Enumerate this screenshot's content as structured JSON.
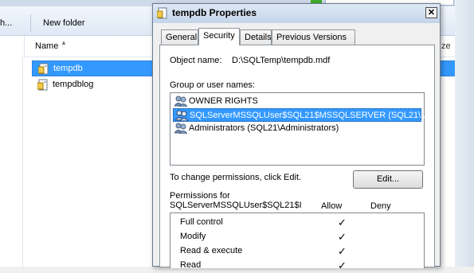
{
  "explorer": {
    "toolbar_partial_text": "h...",
    "new_folder_label": "New folder",
    "column_name_label": "Name",
    "column_size_partial": "ze",
    "files": [
      {
        "name": "tempdb",
        "selected": true
      },
      {
        "name": "tempdblog",
        "selected": false
      }
    ]
  },
  "dialog": {
    "title": "tempdb Properties",
    "close_glyph": "✕",
    "tabs": [
      {
        "label": "General",
        "active": false
      },
      {
        "label": "Security",
        "active": true
      },
      {
        "label": "Details",
        "active": false
      },
      {
        "label": "Previous Versions",
        "active": false
      }
    ],
    "object_name_label": "Object name:",
    "object_name_value": "D:\\SQLTemp\\tempdb.mdf",
    "group_label": "Group or user names:",
    "principals": [
      {
        "name": "OWNER RIGHTS",
        "selected": false
      },
      {
        "name": "SQLServerMSSQLUser$SQL21$MSSQLSERVER (SQL21\\...",
        "selected": true
      },
      {
        "name": "Administrators (SQL21\\Administrators)",
        "selected": false
      }
    ],
    "change_perm_text": "To change permissions, click Edit.",
    "edit_button_label": "Edit...",
    "permissions_for_line1": "Permissions for",
    "permissions_for_line2": "SQLServerMSSQLUser$SQL21$I",
    "allow_header": "Allow",
    "deny_header": "Deny",
    "check_glyph": "✓",
    "permissions": [
      {
        "name": "Full control",
        "allow": true,
        "deny": false
      },
      {
        "name": "Modify",
        "allow": true,
        "deny": false
      },
      {
        "name": "Read & execute",
        "allow": true,
        "deny": false
      },
      {
        "name": "Read",
        "allow": true,
        "deny": false
      }
    ]
  },
  "colors": {
    "selection": "#3399ff",
    "accent_green": "#3fae2a"
  }
}
